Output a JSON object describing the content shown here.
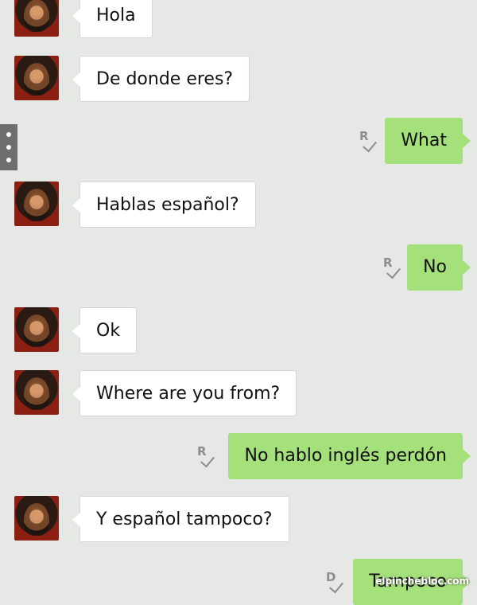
{
  "messages": [
    {
      "direction": "in",
      "text": "Hola"
    },
    {
      "direction": "in",
      "text": "De donde eres?"
    },
    {
      "direction": "out",
      "text": "What",
      "receipt": "R"
    },
    {
      "direction": "in",
      "text": "Hablas español?"
    },
    {
      "direction": "out",
      "text": "No",
      "receipt": "R"
    },
    {
      "direction": "in",
      "text": "Ok"
    },
    {
      "direction": "in",
      "text": "Where are you from?"
    },
    {
      "direction": "out",
      "text": "No hablo inglés perdón",
      "receipt": "R"
    },
    {
      "direction": "in",
      "text": "Y español tampoco?"
    },
    {
      "direction": "out",
      "text": "Tampoco",
      "receipt": "D"
    }
  ],
  "watermark": "elpinchebloc.com",
  "colors": {
    "background": "#e6e8e6",
    "incoming_bubble": "#ffffff",
    "outgoing_bubble": "#a5e17b",
    "receipt": "#8a8f8a"
  }
}
